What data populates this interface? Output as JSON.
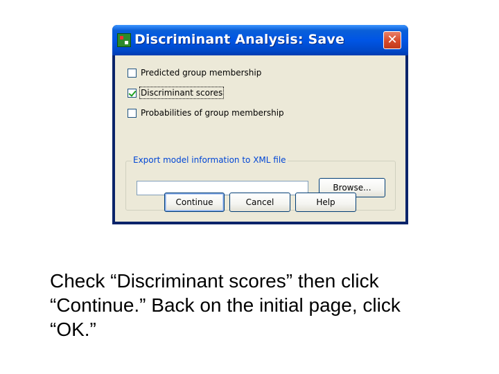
{
  "dialog": {
    "title": "Discriminant Analysis: Save",
    "close_glyph": "✕",
    "options": [
      {
        "label": "Predicted group membership",
        "checked": false
      },
      {
        "label": "Discriminant scores",
        "checked": true
      },
      {
        "label": "Probabilities of group membership",
        "checked": false
      }
    ],
    "export_group": {
      "legend": "Export model information to XML file",
      "file_value": "",
      "browse_label": "Browse..."
    },
    "buttons": {
      "continue": "Continue",
      "cancel": "Cancel",
      "help": "Help"
    }
  },
  "caption": {
    "line1": "Check “Discriminant scores” then click",
    "line2": "“Continue.”  Back on the initial page, click",
    "line3": "“OK.”"
  },
  "icons": {
    "app": "spss-app-icon",
    "close": "close-icon",
    "check": "checkmark-icon"
  },
  "colors": {
    "titlebar": "#0055e5",
    "dialog_bg": "#ece9d8",
    "group_legend": "#0046d5",
    "close_button": "#d64a2a",
    "checkmark": "#21a121"
  }
}
